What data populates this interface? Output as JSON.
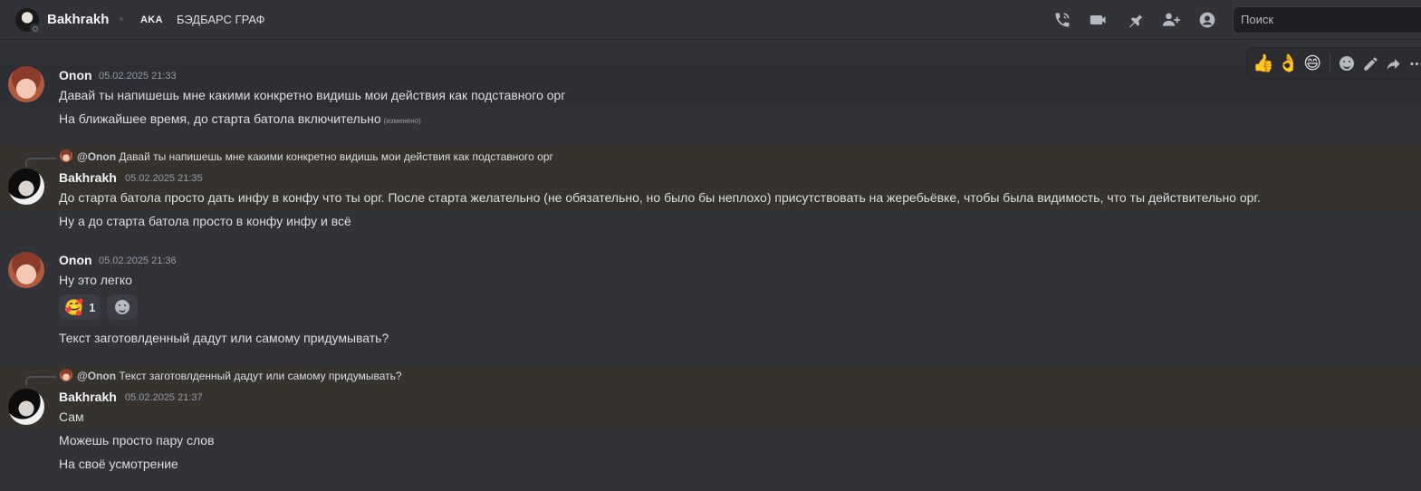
{
  "header": {
    "username": "Bakhrakh",
    "aka_label": "AKA",
    "server_tag": "БЭДБАРС ГРАФ",
    "search_placeholder": "Поиск"
  },
  "icons": {
    "header": [
      "voice-call-icon",
      "video-call-icon",
      "pin-icon",
      "add-friend-icon",
      "profile-icon"
    ],
    "toolbar": [
      "thumbs-up-emoji",
      "ok-hand-emoji",
      "grinning-emoji",
      "add-reaction-icon",
      "edit-icon",
      "forward-icon",
      "more-icon"
    ]
  },
  "toolbar": {
    "emoji_1": "👍",
    "emoji_2": "👌",
    "emoji_3": "😄"
  },
  "messages": [
    {
      "author": "Onon",
      "timestamp": "05.02.2025 21:33",
      "lines": [
        "Давай ты напишешь мне какими конкретно видишь мои действия как подставного орг",
        "На ближайшее время, до старта батола включительно"
      ],
      "edited_label": "(изменено)"
    },
    {
      "reply_to_mention": "@Onon",
      "reply_to_text": "Давай ты напишешь мне какими конкретно видишь мои действия как подставного орг",
      "author": "Bakhrakh",
      "timestamp": "05.02.2025 21:35",
      "lines": [
        "До старта батола просто дать инфу в конфу что ты орг. После старта желательно (не обязательно, но было бы неплохо) присутствовать на жеребьёвке, чтобы была видимость, что ты действительно орг.",
        "Ну а до старта батола просто в конфу инфу и всё"
      ]
    },
    {
      "author": "Onon",
      "timestamp": "05.02.2025 21:36",
      "lines": [
        "Ну это легко",
        "Текст заготовлденный дадут или самому придумывать?"
      ],
      "reaction": {
        "emoji": "🥰",
        "count": "1"
      }
    },
    {
      "reply_to_mention": "@Onon",
      "reply_to_text": "Текст заготовлденный дадут или самому придумывать?",
      "author": "Bakhrakh",
      "timestamp": "05.02.2025 21:37",
      "lines": [
        "Сам",
        "Можешь просто пару слов",
        "На своё усмотрение"
      ]
    }
  ]
}
